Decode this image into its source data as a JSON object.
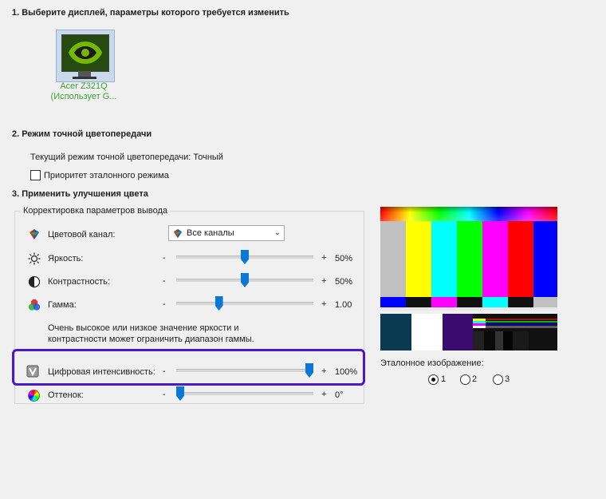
{
  "sections": {
    "s1_title": "1. Выберите дисплей, параметры которого требуется изменить",
    "s2_title": "2. Режим точной цветопередачи",
    "s3_title": "3. Применить улучшения цвета"
  },
  "display": {
    "name_line1": "Acer Z321Q",
    "name_line2": "(Использует G..."
  },
  "accuracy": {
    "current_mode": "Текущий режим точной цветопередачи: Точный",
    "priority_label": "Приоритет эталонного режима",
    "priority_checked": false
  },
  "group": {
    "title": "Корректировка параметров вывода",
    "channel_label": "Цветовой канал:",
    "channel_value": "Все каналы",
    "brightness_label": "Яркость:",
    "brightness_value": "50%",
    "brightness_level": 0.5,
    "contrast_label": "Контрастность:",
    "contrast_value": "50%",
    "contrast_level": 0.5,
    "gamma_label": "Гамма:",
    "gamma_value": "1.00",
    "gamma_level": 0.3,
    "note_line1": "Очень высокое или низкое значение яркости и",
    "note_line2": "контрастности может ограничить диапазон гаммы.",
    "minus": "-",
    "plus": "+"
  },
  "digital": {
    "label": "Цифровая интенсивность:",
    "value": "100%",
    "level": 1.0
  },
  "hue": {
    "label": "Оттенок:",
    "value": "0°",
    "level": 0.0
  },
  "reference": {
    "label": "Эталонное изображение:",
    "options": [
      "1",
      "2",
      "3"
    ],
    "selected": "1"
  },
  "colors": {
    "accent": "#0a78d7",
    "highlight": "#4a19c9",
    "display_name": "#3aa335"
  },
  "icons": {
    "channel": "rgb-channel-icon",
    "brightness": "sun-icon",
    "contrast": "contrast-icon",
    "gamma": "rgb-circles-icon",
    "digital": "vibrance-icon",
    "hue": "color-wheel-icon"
  }
}
